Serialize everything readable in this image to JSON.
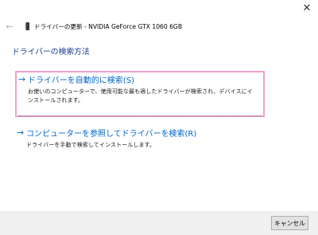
{
  "window": {
    "close_icon": "close-icon",
    "close_glyph": "✕"
  },
  "header": {
    "back_icon": "back-arrow-icon",
    "back_glyph": "←",
    "device_icon": "graphics-card-icon",
    "title": "ドライバーの更新 - NVIDIA GeForce GTX 1060 6GB"
  },
  "main": {
    "heading": "ドライバーの検索方法",
    "options": [
      {
        "icon": "arrow-right-icon",
        "arrow": "→",
        "title": "ドライバーを自動的に検索(S)",
        "description": "お使いのコンピューターで、使用可能な最も適したドライバーが検索され、デバイスにインストールされます。"
      },
      {
        "icon": "arrow-right-icon",
        "arrow": "→",
        "title": "コンピューターを参照してドライバーを検索(R)",
        "description": "ドライバーを手動で検索してインストールします。"
      }
    ]
  },
  "footer": {
    "cancel_label": "キャンセル"
  },
  "colors": {
    "link": "#0066cc",
    "heading": "#1e3c96",
    "focus_border": "#f4a0cc",
    "footer_bg": "#f0f0f0"
  }
}
